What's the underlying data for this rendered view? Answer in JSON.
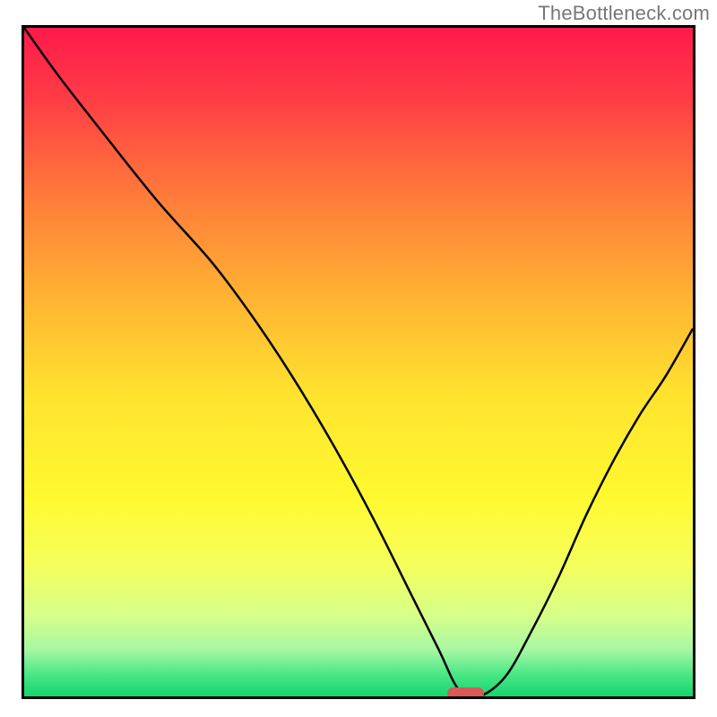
{
  "watermark": {
    "text": "TheBottleneck.com"
  },
  "chart_data": {
    "type": "line",
    "title": "",
    "xlabel": "",
    "ylabel": "",
    "xlim": [
      0,
      100
    ],
    "ylim": [
      0,
      100
    ],
    "grid": false,
    "legend": false,
    "background_gradient": {
      "stops": [
        {
          "pos": 0.0,
          "color": "#ff1a4b"
        },
        {
          "pos": 0.1,
          "color": "#ff3a46"
        },
        {
          "pos": 0.25,
          "color": "#ff7a3a"
        },
        {
          "pos": 0.4,
          "color": "#ffb233"
        },
        {
          "pos": 0.55,
          "color": "#ffe32f"
        },
        {
          "pos": 0.7,
          "color": "#fff92f"
        },
        {
          "pos": 0.8,
          "color": "#f6ff5a"
        },
        {
          "pos": 0.88,
          "color": "#d6ff8a"
        },
        {
          "pos": 0.93,
          "color": "#a7f7a2"
        },
        {
          "pos": 0.965,
          "color": "#4fe887"
        },
        {
          "pos": 1.0,
          "color": "#12d66e"
        }
      ]
    },
    "series": [
      {
        "name": "bottleneck-curve",
        "color": "#000000",
        "stroke_width": 2.5,
        "x": [
          0,
          5,
          12,
          20,
          28,
          34,
          40,
          46,
          52,
          58,
          62,
          65,
          68,
          72,
          76,
          80,
          84,
          88,
          92,
          96,
          100
        ],
        "y": [
          100,
          93,
          84,
          74,
          65,
          57,
          48,
          38,
          27,
          15,
          7,
          1,
          0,
          3,
          10,
          18,
          27,
          35,
          42,
          48,
          55
        ]
      }
    ],
    "marker": {
      "name": "optimal-marker",
      "shape": "pill",
      "color": "#d65a5a",
      "x_center": 66,
      "y_center": 0.5,
      "width_pct": 5.5,
      "height_pct": 1.8
    }
  }
}
